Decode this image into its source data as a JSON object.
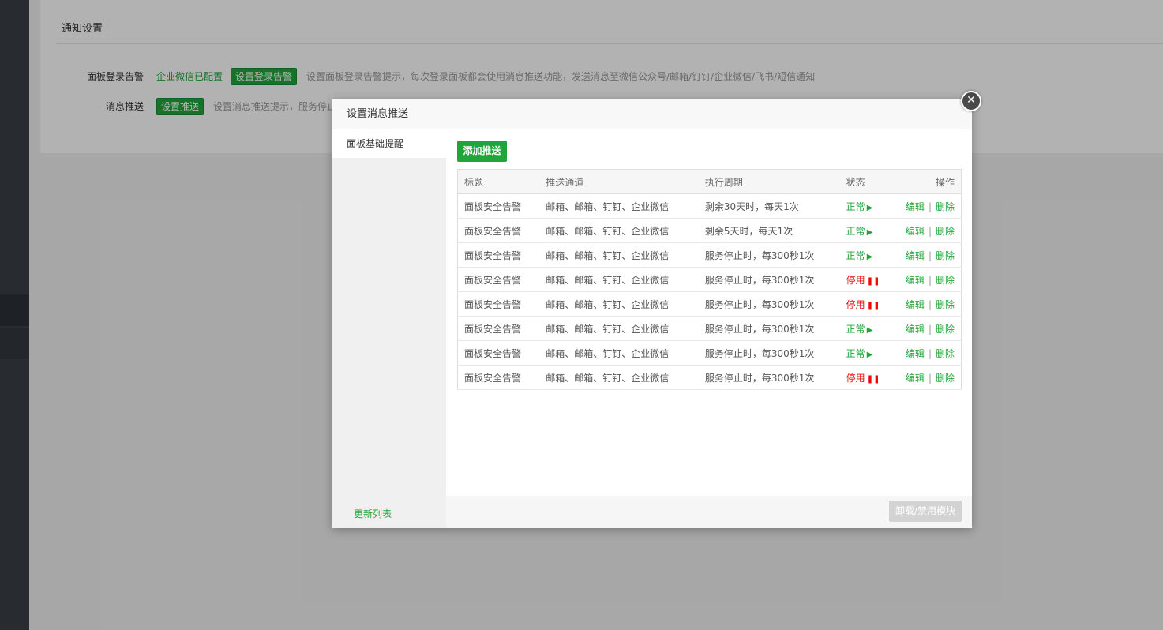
{
  "page": {
    "panel_title": "通知设置",
    "rows": [
      {
        "label": "面板登录告警",
        "status_link": "企业微信已配置",
        "button": "设置登录告警",
        "hint": "设置面板登录告警提示，每次登录面板都会使用消息推送功能，发送消息至微信公众号/邮箱/钉钉/企业微信/飞书/短信通知"
      },
      {
        "label": "消息推送",
        "button": "设置推送",
        "hint": "设置消息推送提示，服务停止时将"
      }
    ]
  },
  "modal": {
    "title": "设置消息推送",
    "close_icon": "close-icon",
    "sidebar_items": [
      "面板基础提醒"
    ],
    "refresh_label": "更新列表",
    "add_button": "添加推送",
    "footer_button": "卸载/禁用模块",
    "table": {
      "headers": [
        "标题",
        "推送通道",
        "执行周期",
        "状态",
        "操作"
      ],
      "rows": [
        {
          "title": "面板安全告警",
          "channel": "邮箱、邮箱、钉钉、企业微信",
          "cycle": "剩余30天时，每天1次",
          "status": "正常",
          "status_type": "on"
        },
        {
          "title": "面板安全告警",
          "channel": "邮箱、邮箱、钉钉、企业微信",
          "cycle": "剩余5天时，每天1次",
          "status": "正常",
          "status_type": "on"
        },
        {
          "title": "面板安全告警",
          "channel": "邮箱、邮箱、钉钉、企业微信",
          "cycle": "服务停止时，每300秒1次",
          "status": "正常",
          "status_type": "on"
        },
        {
          "title": "面板安全告警",
          "channel": "邮箱、邮箱、钉钉、企业微信",
          "cycle": "服务停止时，每300秒1次",
          "status": "停用",
          "status_type": "off"
        },
        {
          "title": "面板安全告警",
          "channel": "邮箱、邮箱、钉钉、企业微信",
          "cycle": "服务停止时，每300秒1次",
          "status": "停用",
          "status_type": "off"
        },
        {
          "title": "面板安全告警",
          "channel": "邮箱、邮箱、钉钉、企业微信",
          "cycle": "服务停止时，每300秒1次",
          "status": "正常",
          "status_type": "on"
        },
        {
          "title": "面板安全告警",
          "channel": "邮箱、邮箱、钉钉、企业微信",
          "cycle": "服务停止时，每300秒1次",
          "status": "正常",
          "status_type": "on"
        },
        {
          "title": "面板安全告警",
          "channel": "邮箱、邮箱、钉钉、企业微信",
          "cycle": "服务停止时，每300秒1次",
          "status": "停用",
          "status_type": "off"
        }
      ],
      "edit_label": "编辑",
      "delete_label": "删除",
      "separator": "|"
    }
  },
  "colors": {
    "accent": "#20a53a",
    "danger": "#ef0808"
  }
}
